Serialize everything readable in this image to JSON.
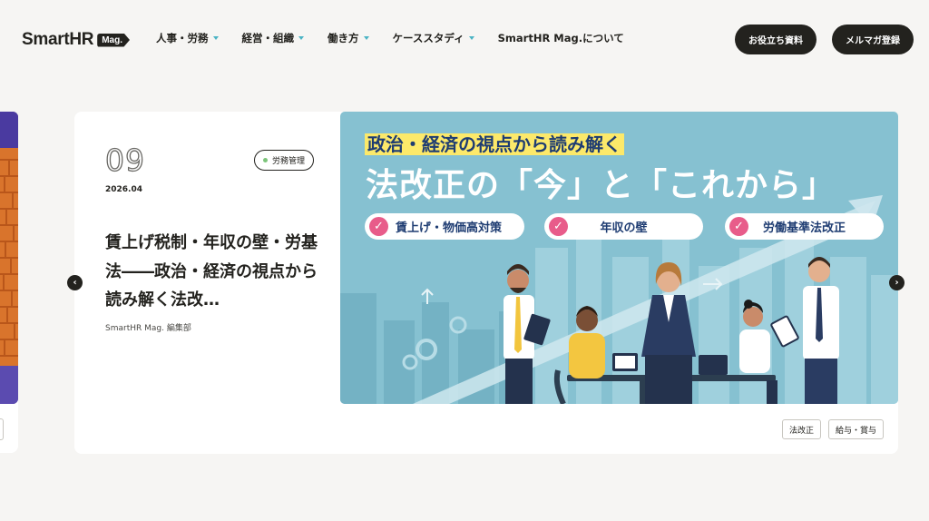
{
  "header": {
    "logo_text": "SmartHR",
    "logo_tag": "Mag.",
    "nav": [
      {
        "label": "人事・労務",
        "dropdown": true
      },
      {
        "label": "経営・組織",
        "dropdown": true
      },
      {
        "label": "働き方",
        "dropdown": true
      },
      {
        "label": "ケーススタディ",
        "dropdown": true
      },
      {
        "label": "SmartHR Mag.について",
        "dropdown": false
      }
    ],
    "docs_button": "お役立ち資料",
    "newsletter_button": "メルマガ登録"
  },
  "featured": {
    "number": "09",
    "date": "2026.04",
    "category": "労務管理",
    "title": "賃上げ税制・年収の壁・労基法――政治・経済の視点から読み解く法改…",
    "author": "SmartHR Mag. 編集部",
    "hero": {
      "subtitle": "政治・経済の視点から読み解く",
      "main_title": "法改正の「今」と「これから」",
      "points": [
        "賃上げ・物価高対策",
        "年収の壁",
        "労働基準法改正"
      ]
    },
    "tags": [
      "法改正",
      "給与・賞与"
    ]
  },
  "carousel": {
    "prev_symbol": "‹",
    "next_symbol": "›"
  },
  "colors": {
    "ink": "#23221e",
    "accent_caret": "#4ab3c4",
    "hero_bg": "#86c1d1",
    "highlight": "#fce96a",
    "check": "#e85c8a"
  }
}
